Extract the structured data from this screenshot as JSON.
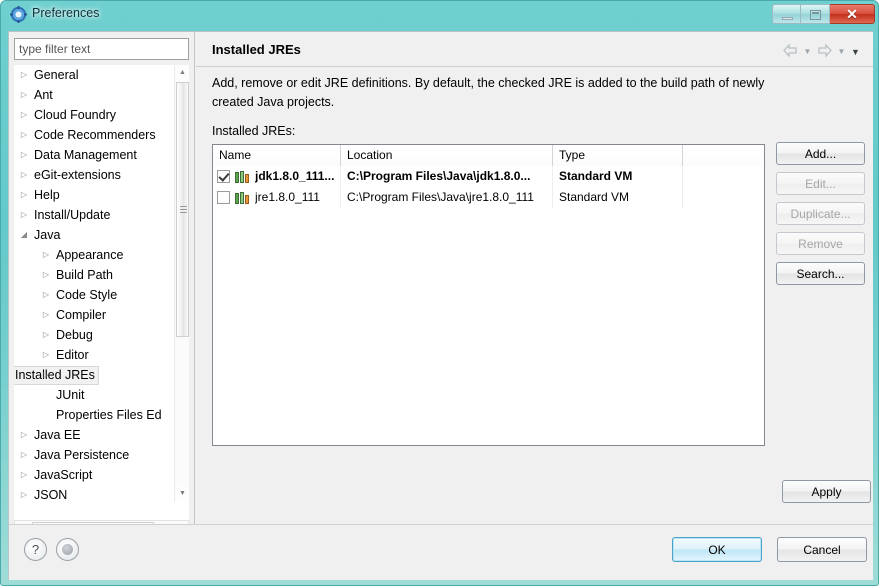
{
  "window": {
    "title": "Preferences",
    "icon": "gear-icon",
    "controls": {
      "minimize": "–",
      "maximize": "□",
      "close": "✕"
    }
  },
  "sidebar": {
    "filter": {
      "placeholder": "type filter text",
      "value": ""
    },
    "items": [
      {
        "label": "General",
        "level": 0,
        "expandable": true,
        "expanded": false,
        "selected": false
      },
      {
        "label": "Ant",
        "level": 0,
        "expandable": true,
        "expanded": false,
        "selected": false
      },
      {
        "label": "Cloud Foundry",
        "level": 0,
        "expandable": true,
        "expanded": false,
        "selected": false
      },
      {
        "label": "Code Recommenders",
        "level": 0,
        "expandable": true,
        "expanded": false,
        "selected": false
      },
      {
        "label": "Data Management",
        "level": 0,
        "expandable": true,
        "expanded": false,
        "selected": false
      },
      {
        "label": "eGit-extensions",
        "level": 0,
        "expandable": true,
        "expanded": false,
        "selected": false
      },
      {
        "label": "Help",
        "level": 0,
        "expandable": true,
        "expanded": false,
        "selected": false
      },
      {
        "label": "Install/Update",
        "level": 0,
        "expandable": true,
        "expanded": false,
        "selected": false
      },
      {
        "label": "Java",
        "level": 0,
        "expandable": true,
        "expanded": true,
        "selected": false
      },
      {
        "label": "Appearance",
        "level": 1,
        "expandable": true,
        "expanded": false,
        "selected": false
      },
      {
        "label": "Build Path",
        "level": 1,
        "expandable": true,
        "expanded": false,
        "selected": false
      },
      {
        "label": "Code Style",
        "level": 1,
        "expandable": true,
        "expanded": false,
        "selected": false
      },
      {
        "label": "Compiler",
        "level": 1,
        "expandable": true,
        "expanded": false,
        "selected": false
      },
      {
        "label": "Debug",
        "level": 1,
        "expandable": true,
        "expanded": false,
        "selected": false
      },
      {
        "label": "Editor",
        "level": 1,
        "expandable": true,
        "expanded": false,
        "selected": false
      },
      {
        "label": "Installed JREs",
        "level": 1,
        "expandable": true,
        "expanded": false,
        "selected": true
      },
      {
        "label": "JUnit",
        "level": 1,
        "expandable": false,
        "expanded": false,
        "selected": false
      },
      {
        "label": "Properties Files Ed",
        "level": 1,
        "expandable": false,
        "expanded": false,
        "selected": false
      },
      {
        "label": "Java EE",
        "level": 0,
        "expandable": true,
        "expanded": false,
        "selected": false
      },
      {
        "label": "Java Persistence",
        "level": 0,
        "expandable": true,
        "expanded": false,
        "selected": false
      },
      {
        "label": "JavaScript",
        "level": 0,
        "expandable": true,
        "expanded": false,
        "selected": false
      },
      {
        "label": "JSON",
        "level": 0,
        "expandable": true,
        "expanded": false,
        "selected": false
      }
    ],
    "glyphs": {
      "collapsed": "▷",
      "expanded": "◢",
      "scroll_up": "▲",
      "scroll_down": "▼",
      "scroll_left": "◀",
      "scroll_right": "▶"
    }
  },
  "page": {
    "title": "Installed JREs",
    "description": "Add, remove or edit JRE definitions. By default, the checked JRE is added to the build path of newly created Java projects.",
    "list_label": "Installed JREs:",
    "nav": {
      "back": "⇦",
      "back_menu": "▼",
      "forward": "⇨",
      "forward_menu": "▼",
      "view_menu": "▼"
    }
  },
  "table": {
    "columns": [
      "Name",
      "Location",
      "Type",
      ""
    ],
    "rows": [
      {
        "checked": true,
        "bold": true,
        "name": "jdk1.8.0_111...",
        "location": "C:\\Program Files\\Java\\jdk1.8.0...",
        "type": "Standard VM",
        "blank": ""
      },
      {
        "checked": false,
        "bold": false,
        "name": "jre1.8.0_111",
        "location": "C:\\Program Files\\Java\\jre1.8.0_111",
        "type": "Standard VM",
        "blank": ""
      }
    ]
  },
  "side_buttons": [
    {
      "label": "Add...",
      "enabled": true
    },
    {
      "label": "Edit...",
      "enabled": false
    },
    {
      "label": "Duplicate...",
      "enabled": false
    },
    {
      "label": "Remove",
      "enabled": false
    },
    {
      "label": "Search...",
      "enabled": true
    }
  ],
  "footer": {
    "apply": "Apply",
    "ok": "OK",
    "cancel": "Cancel",
    "help_glyph": "?"
  },
  "colors": {
    "titlebar": "#63c9c9",
    "close_button": "#c3301d",
    "default_button_accent": "#4aa3c9",
    "dialog_background": "#f0f0f0"
  }
}
